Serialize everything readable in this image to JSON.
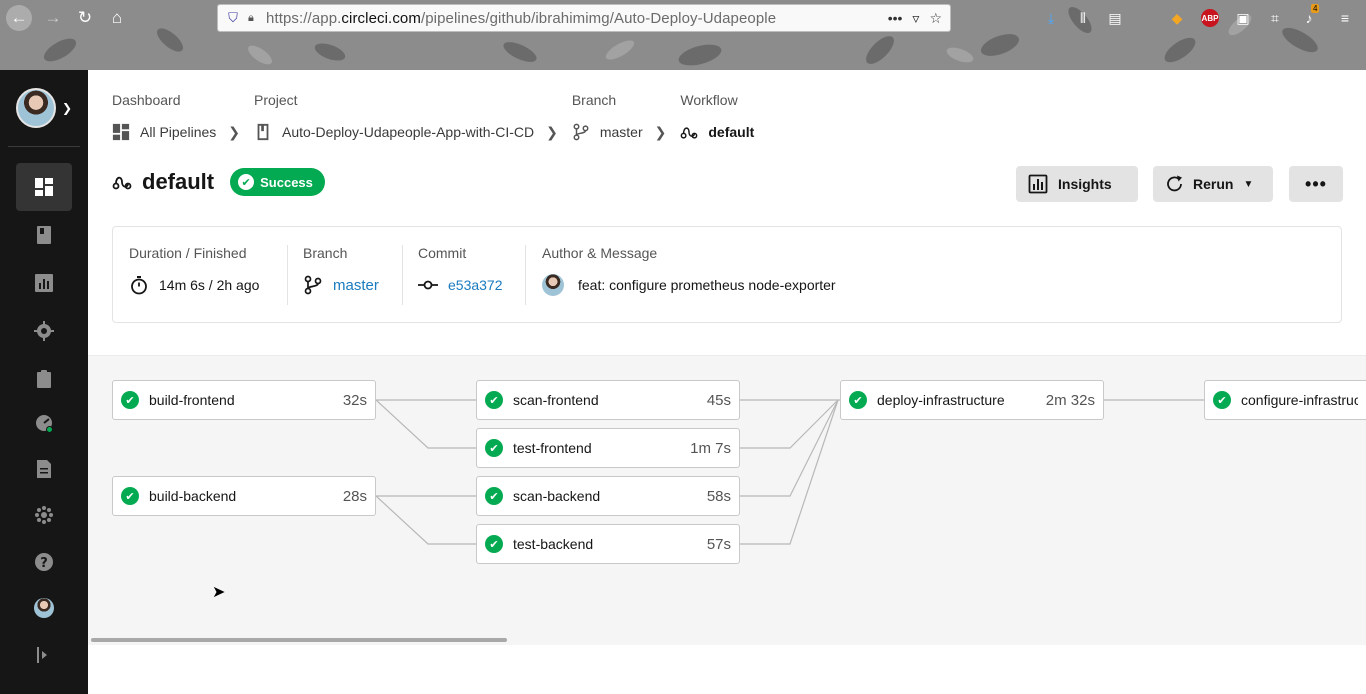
{
  "browser": {
    "url_prefix": "https://app.",
    "url_domain": "circleci.com",
    "url_rest": "/pipelines/github/ibrahimimg/Auto-Deploy-Udapeople",
    "extension_badge": "4"
  },
  "breadcrumb": {
    "dashboard": {
      "label": "Dashboard",
      "value": "All Pipelines"
    },
    "project": {
      "label": "Project",
      "value": "Auto-Deploy-Udapeople-App-with-CI-CD"
    },
    "branch": {
      "label": "Branch",
      "value": "master"
    },
    "workflow": {
      "label": "Workflow",
      "value": "default"
    }
  },
  "header": {
    "title": "default",
    "status": "Success",
    "insights_label": "Insights",
    "rerun_label": "Rerun",
    "more_label": "•••"
  },
  "summary": {
    "duration_label": "Duration / Finished",
    "duration_value": "14m 6s / 2h ago",
    "branch_label": "Branch",
    "branch_value": "master",
    "commit_label": "Commit",
    "commit_value": "e53a372",
    "author_label": "Author & Message",
    "author_message": "feat: configure prometheus node-exporter"
  },
  "jobs": [
    {
      "name": "build-frontend",
      "duration": "32s"
    },
    {
      "name": "build-backend",
      "duration": "28s"
    },
    {
      "name": "scan-frontend",
      "duration": "45s"
    },
    {
      "name": "test-frontend",
      "duration": "1m 7s"
    },
    {
      "name": "scan-backend",
      "duration": "58s"
    },
    {
      "name": "test-backend",
      "duration": "57s"
    },
    {
      "name": "deploy-infrastructure",
      "duration": "2m 32s"
    },
    {
      "name": "configure-infrastructure",
      "duration": ""
    }
  ],
  "colors": {
    "success": "#04aa51",
    "link": "#1a7bbf",
    "sidebar": "#161616"
  }
}
